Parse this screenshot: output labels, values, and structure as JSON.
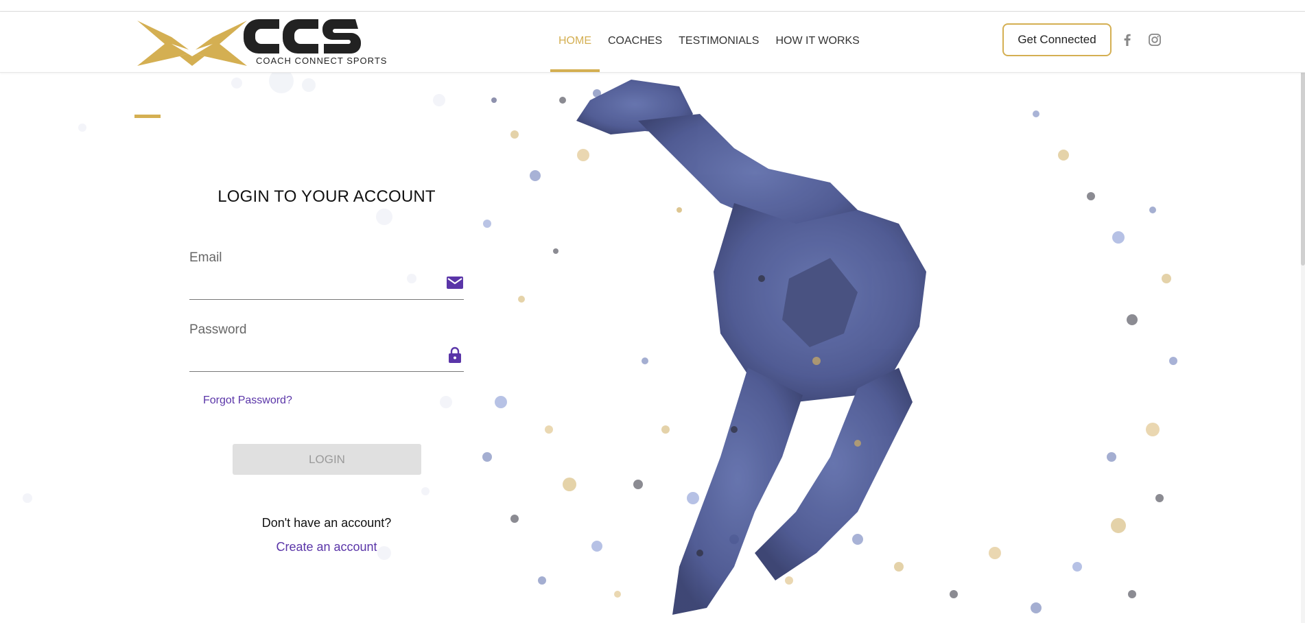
{
  "brand": {
    "logo_text": "CCS",
    "tagline": "COACH CONNECT SPORTS",
    "accent_color": "#d4af52",
    "link_color": "#5a35a8"
  },
  "nav": {
    "items": [
      {
        "label": "HOME",
        "active": true
      },
      {
        "label": "COACHES",
        "active": false
      },
      {
        "label": "TESTIMONIALS",
        "active": false
      },
      {
        "label": "HOW IT WORKS",
        "active": false
      }
    ],
    "cta_label": "Get Connected",
    "social": [
      "facebook-icon",
      "instagram-icon"
    ]
  },
  "login": {
    "title": "LOGIN TO YOUR ACCOUNT",
    "email_label": "Email",
    "email_value": "",
    "email_icon": "envelope-icon",
    "password_label": "Password",
    "password_value": "",
    "password_icon": "lock-icon",
    "forgot_label": "Forgot Password?",
    "submit_label": "LOGIN",
    "no_account_text": "Don't have an account?",
    "create_label": "Create an account"
  }
}
